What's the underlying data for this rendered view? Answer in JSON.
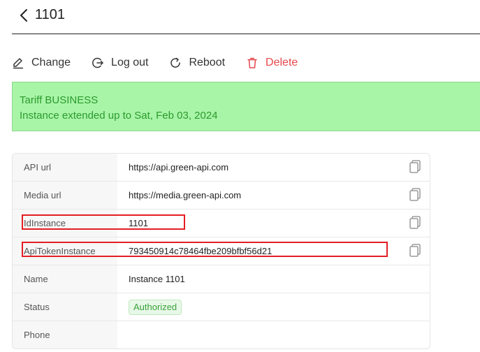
{
  "header": {
    "title": "1101"
  },
  "actions": {
    "change_label": "Change",
    "logout_label": "Log out",
    "reboot_label": "Reboot",
    "delete_label": "Delete"
  },
  "banner": {
    "tariff": "Tariff BUSINESS",
    "extended": "Instance extended up to Sat, Feb 03, 2024"
  },
  "details": {
    "rows": [
      {
        "label": "API url",
        "value": "https://api.green-api.com"
      },
      {
        "label": "Media url",
        "value": "https://media.green-api.com"
      },
      {
        "label": "IdInstance",
        "value": "1101"
      },
      {
        "label": "ApiTokenInstance",
        "value": "793450914c78464fbe209bfbf56d21"
      },
      {
        "label": "Name",
        "value": "Instance 1101"
      },
      {
        "label": "Status",
        "value": "Authorized"
      },
      {
        "label": "Phone",
        "value": ""
      }
    ]
  },
  "colors": {
    "banner_bg": "#a8f5a8",
    "banner_text": "#2c9a2c",
    "danger": "#e5484d",
    "highlight": "#e31e24",
    "status_badge": "#3aa33a"
  },
  "icons": {
    "back": "chevron-left-icon",
    "change": "pencil-icon",
    "logout": "logout-icon",
    "reboot": "refresh-icon",
    "delete": "trash-icon",
    "copy": "copy-icon"
  }
}
